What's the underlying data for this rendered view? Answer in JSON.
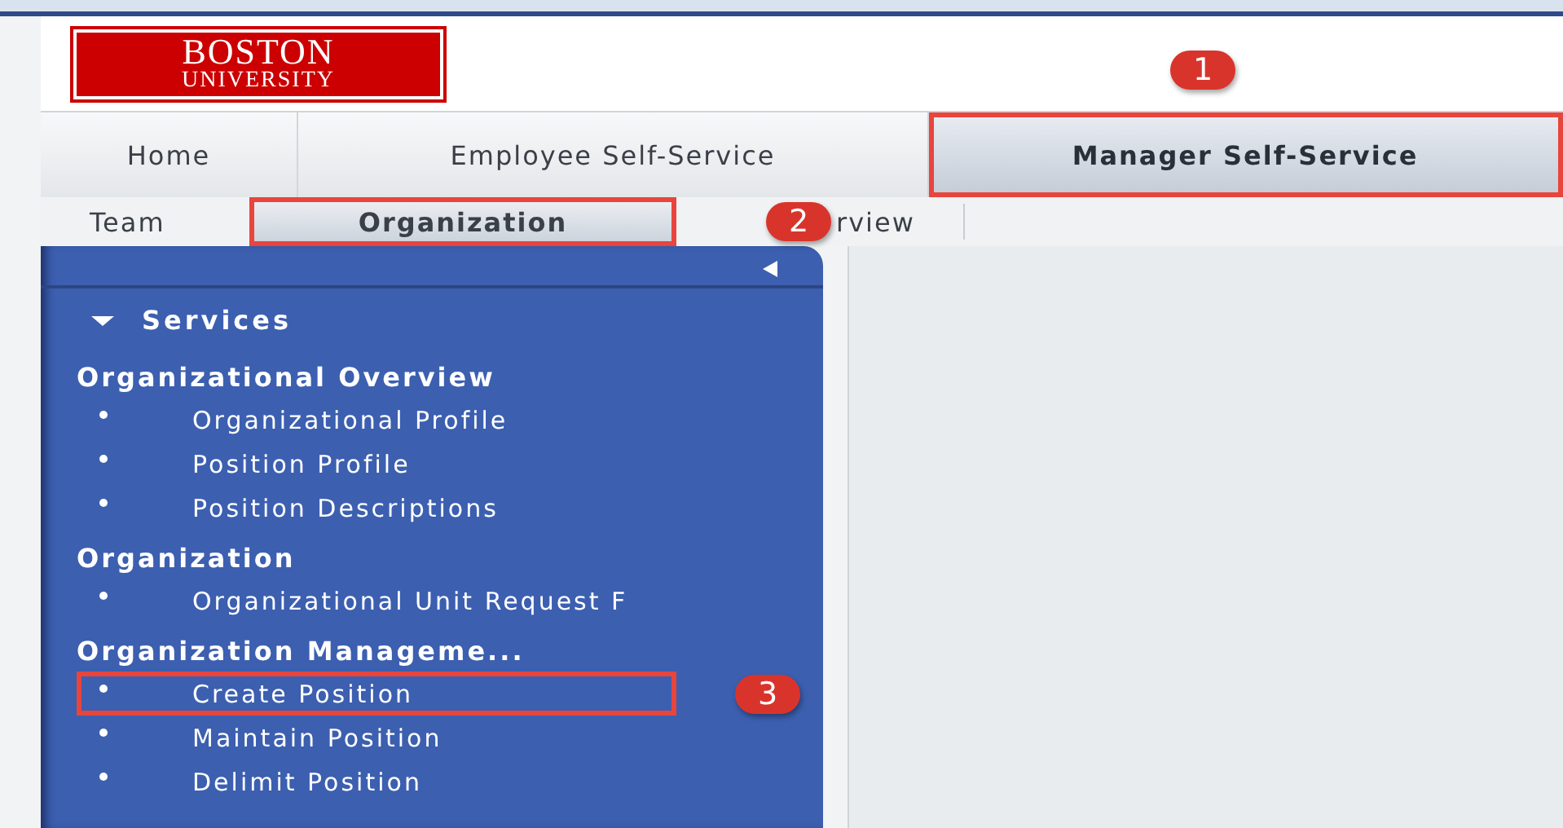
{
  "logo": {
    "line_1": "BOSTON",
    "line_2": "UNIVERSITY"
  },
  "tabs": [
    {
      "label": "Home",
      "selected": false
    },
    {
      "label": "Employee Self-Service",
      "selected": false
    },
    {
      "label": "Manager Self-Service",
      "selected": true,
      "boxed": true,
      "callout": "1"
    }
  ],
  "subtabs": [
    {
      "label": "Team",
      "selected": false
    },
    {
      "label": "Organization",
      "selected": true,
      "boxed": true,
      "callout": "2"
    },
    {
      "label": "rview",
      "selected": false
    }
  ],
  "sidebar": {
    "section": {
      "label": "Services",
      "expanded": true
    },
    "groups": [
      {
        "heading": "Organizational Overview",
        "items": [
          {
            "label": "Organizational Profile"
          },
          {
            "label": "Position Profile"
          },
          {
            "label": "Position Descriptions"
          }
        ]
      },
      {
        "heading": "Organization",
        "items": [
          {
            "label": "Organizational Unit Request F"
          }
        ]
      },
      {
        "heading": "Organization Manageme...",
        "items": [
          {
            "label": "Create Position",
            "boxed": true,
            "callout": "3"
          },
          {
            "label": "Maintain Position"
          },
          {
            "label": "Delimit Position"
          }
        ]
      }
    ]
  }
}
